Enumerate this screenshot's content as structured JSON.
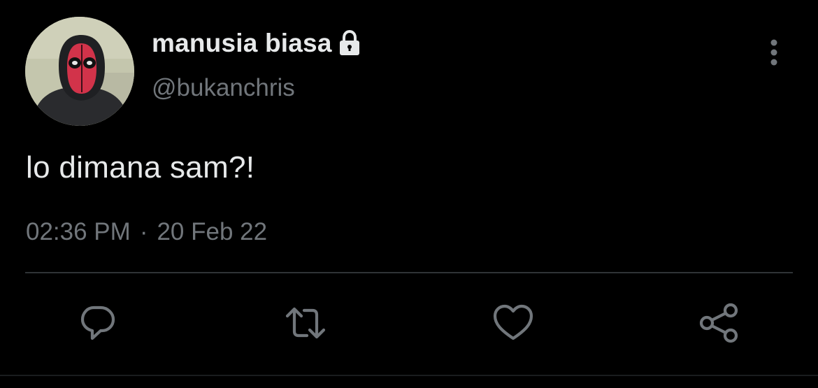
{
  "tweet": {
    "display_name": "manusia biasa",
    "handle": "@bukanchris",
    "text": "lo dimana sam?!",
    "time": "02:36 PM",
    "separator": "·",
    "date": "20 Feb 22",
    "protected": true
  },
  "icons": {
    "lock": "lock-icon",
    "more": "more-vertical-icon",
    "reply": "reply-icon",
    "retweet": "retweet-icon",
    "like": "heart-icon",
    "share": "share-icon"
  },
  "colors": {
    "background": "#000000",
    "primary_text": "#e7e9ea",
    "secondary_text": "#71767b",
    "divider": "#2f3336"
  }
}
